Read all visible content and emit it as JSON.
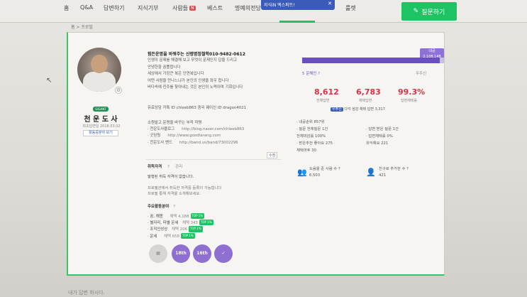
{
  "nav": {
    "items": [
      "홈",
      "Q&A",
      "답변하기",
      "지식기부",
      "사람들",
      "베스트",
      "명예의전당",
      "룰렛"
    ],
    "people_badge": "N",
    "popup_text": "지식iN 엑스퍼트!",
    "ask_label": "질문하기"
  },
  "breadcrumb": "홈 > 프로필",
  "profile": {
    "rank_pill": "GIGANT",
    "name": "천 운 도 사",
    "sub": "최초답변일 2018.03.02",
    "expert_link": "활동중분야 보기",
    "intro_title": "힘든운명을 바꿔주는 신령명정철학010-9482-0612",
    "intro_lines": [
      "인생의 문제를 해결해 보고 무엇이 문제인지 답을 드리고",
      "안녕한함 꿈틀합니다",
      "세상에서 가장큰 복은 인연복입니다",
      "어떤 사람을 만나느냐가 본인의 인생을 좌우 합니다",
      "버다속에 진주를 찾아내는 것은 본인의 노력이며 기회입니다"
    ],
    "contact": "유료상담 카톡 ID chleeb863 중국 웨이신 ID dragon4021",
    "sites_title": "소원발고 운명을 바꾸는 부적 작명",
    "sites": [
      {
        "label": "· 천운도사블로그",
        "url": "http://blog.naver.com/chleeb863"
      },
      {
        "label": "· 굿당링",
        "url": "http://www.goodlarang.com"
      },
      {
        "label": "· 천운도사 밴드",
        "url": "http://band.us/band/73002296"
      }
    ],
    "edit_tag": "수정",
    "cert_title": "취득자격",
    "cert_count": "?",
    "cert_manage": "관리",
    "cert_empty": "말행된 취득 자격이 없습니다.",
    "cert_note_1": "프로필관에서 취득한 자격증 등록이 가능합니다",
    "cert_note_2": "프로필 통해 자격을 소개해보세요.",
    "activity_title": "주요활동분야",
    "activity_count": "?",
    "activities": [
      {
        "label": "· 꿈, 해몽",
        "meta": "채택 4,188"
      },
      {
        "label": "· 별자리, 띠별 운세",
        "meta": "채택 343"
      },
      {
        "label": "· 조직인성상",
        "meta": "채택 206"
      },
      {
        "label": "· 운세",
        "meta": "채택 658"
      }
    ],
    "top_tag": "TOP 1%",
    "badges": [
      "18th",
      "16th",
      "✓"
    ]
  },
  "stats": {
    "level_tag": "내공",
    "level_value": "2,108,148",
    "level_progress": 0.97,
    "level_left": "5 운해인 ?",
    "level_right": "우주신",
    "answers": "8,612",
    "answers_label": "전체답변",
    "adopted": "6,783",
    "adopted_label": "채택답변",
    "rate": "99.3%",
    "rate_label": "답변채택률",
    "note_pill": "우주신",
    "note_text": "다각 삼감 채택 답변 3,317",
    "details_col1": [
      "· 내공순위    857위",
      "· 질문        전체질문 1건",
      "               전체마감률 100%",
      "· 받은추천    좋아요 275",
      "               채택마후 30"
    ],
    "details_col2": [
      "· 답변 받은 질문 1건",
      "· 답변채택률 0%",
      "유익해요 221"
    ],
    "follower_label": "도움을 준 사람 수 ?",
    "follower_value": "6,503",
    "friend_label": "친구로 추가한 수 ?",
    "friend_value": "421"
  },
  "footer_text": "내가 답변 하시다."
}
